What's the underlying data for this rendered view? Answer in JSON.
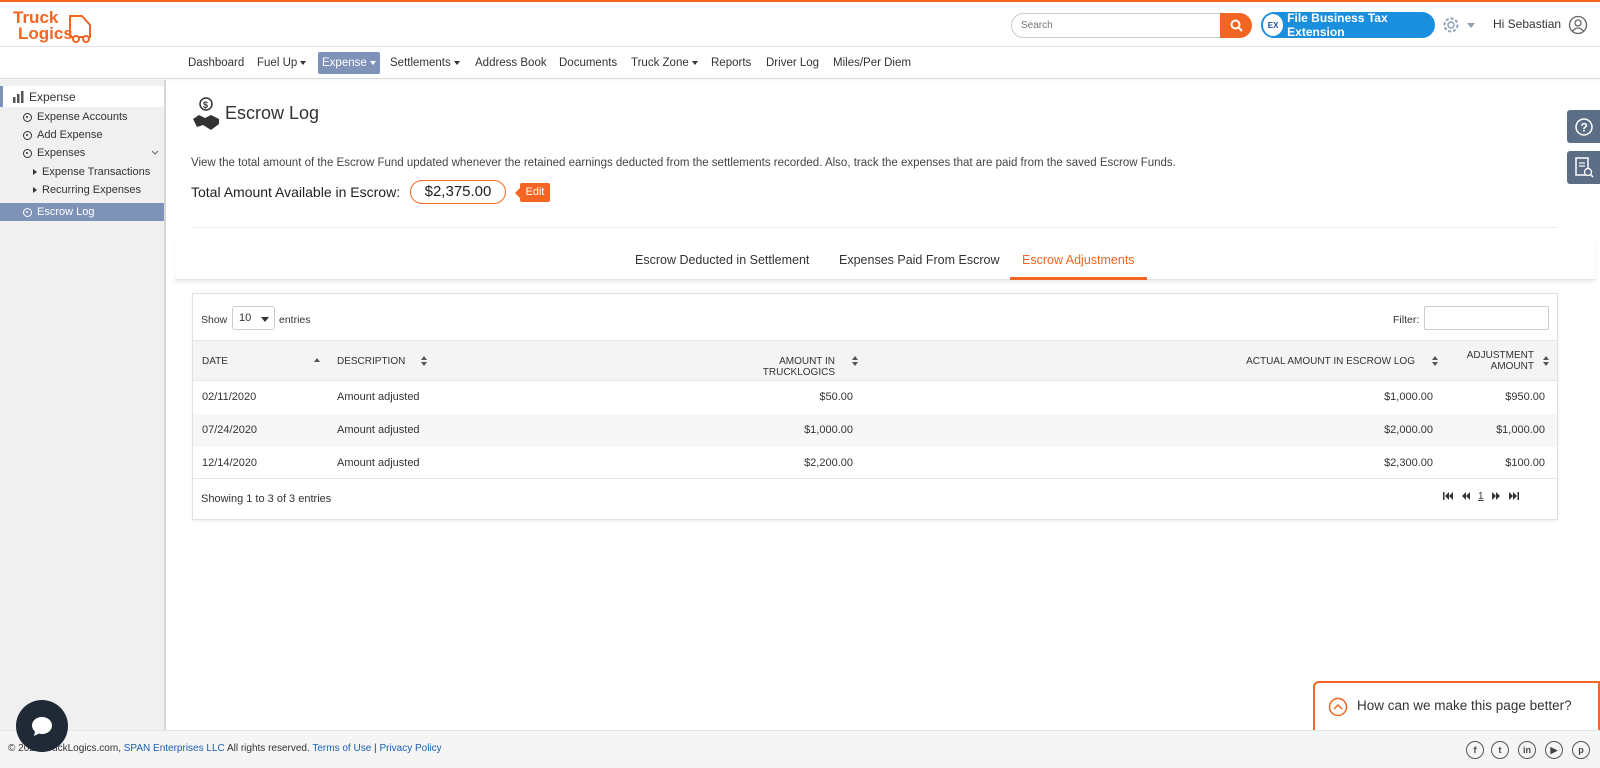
{
  "app": {
    "logo_line1": "Truck",
    "logo_line2": "Logics",
    "brand_color": "#f26522",
    "accent_color": "#7f93b8"
  },
  "header": {
    "search_placeholder": "Search",
    "search_icon": "search-icon",
    "tax_badge": "EX",
    "tax_button": "File Business Tax Extension",
    "settings_icon": "gear-icon",
    "greeting": "Hi Sebastian",
    "user_icon": "user-circle-icon"
  },
  "nav": {
    "items": [
      {
        "label": "Dashboard"
      },
      {
        "label": "Fuel Up"
      },
      {
        "label": "Expense"
      },
      {
        "label": "Settlements"
      },
      {
        "label": "Address Book"
      },
      {
        "label": "Documents"
      },
      {
        "label": "Truck Zone"
      },
      {
        "label": "Reports"
      },
      {
        "label": "Driver Log"
      },
      {
        "label": "Miles/Per Diem"
      }
    ]
  },
  "sidebar": {
    "heading": "Expense",
    "items": [
      {
        "label": "Expense Accounts"
      },
      {
        "label": "Add Expense"
      },
      {
        "label": "Expenses"
      },
      {
        "label": "Expense Transactions"
      },
      {
        "label": "Recurring Expenses"
      },
      {
        "label": "Escrow Log"
      }
    ]
  },
  "page": {
    "title": "Escrow Log",
    "description": "View the total amount of the Escrow Fund updated whenever the retained earnings deducted from the settlements recorded. Also, track the expenses that are paid from the saved Escrow Funds.",
    "total_label": "Total Amount Available in Escrow:",
    "total_amount": "$2,375.00",
    "edit_label": "Edit"
  },
  "tabs": [
    {
      "label": "Escrow Deducted in Settlement"
    },
    {
      "label": "Expenses Paid From Escrow"
    },
    {
      "label": "Escrow Adjustments",
      "active": true
    }
  ],
  "table": {
    "show_label": "Show",
    "entries_value": "10",
    "entries_label": "entries",
    "filter_label": "Filter:",
    "columns": {
      "date": "DATE",
      "description": "DESCRIPTION",
      "amount_tl": "AMOUNT IN TRUCKLOGICS",
      "actual": "ACTUAL AMOUNT IN ESCROW LOG",
      "adj_line1": "ADJUSTMENT",
      "adj_line2": "AMOUNT"
    },
    "rows": [
      {
        "date": "02/11/2020",
        "description": "Amount adjusted",
        "amount_tl": "$50.00",
        "actual": "$1,000.00",
        "adjustment": "$950.00"
      },
      {
        "date": "07/24/2020",
        "description": "Amount adjusted",
        "amount_tl": "$1,000.00",
        "actual": "$2,000.00",
        "adjustment": "$1,000.00"
      },
      {
        "date": "12/14/2020",
        "description": "Amount adjusted",
        "amount_tl": "$2,200.00",
        "actual": "$2,300.00",
        "adjustment": "$100.00"
      }
    ],
    "info": "Showing 1 to 3 of 3 entries",
    "current_page": "1"
  },
  "feedback": {
    "text": "How can we make this page better?"
  },
  "footer": {
    "copyright": "© 2021 TruckLogics.com, ",
    "company": "SPAN Enterprises LLC",
    "rights": " All rights reserved. ",
    "terms": "Terms of Use",
    "sep": " | ",
    "privacy": "Privacy Policy",
    "social": [
      "facebook-icon",
      "twitter-icon",
      "linkedin-icon",
      "youtube-icon",
      "pinterest-icon"
    ]
  }
}
